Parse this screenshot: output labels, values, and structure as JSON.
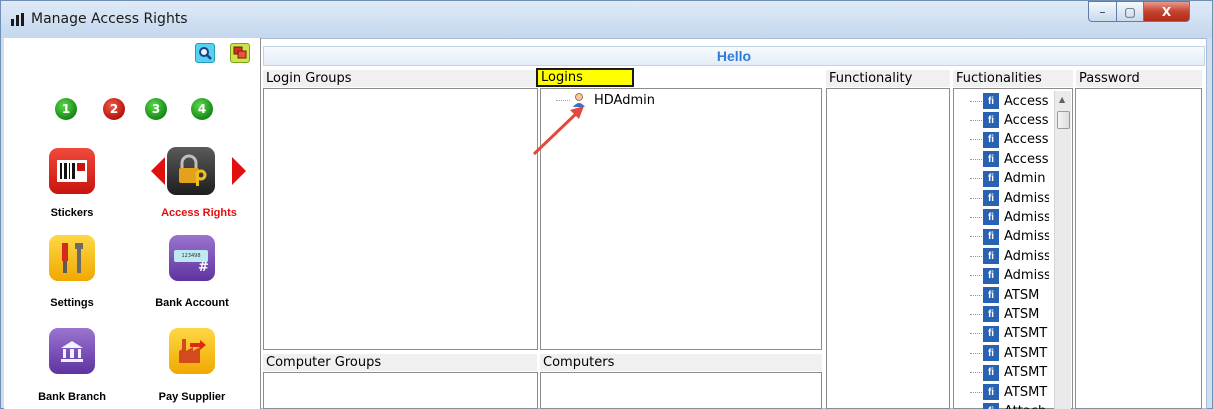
{
  "window": {
    "title": "Manage Access Rights",
    "controls": {
      "minimize": "–",
      "maximize": "▢",
      "close": "X"
    }
  },
  "toolbar": {
    "search_icon": "search-icon",
    "window_icon": "windows-icon"
  },
  "steps": [
    "1",
    "2",
    "3",
    "4"
  ],
  "tiles": [
    {
      "label": "Stickers",
      "icon": "barcode-icon"
    },
    {
      "label": "Access Rights",
      "icon": "padlock-key-icon"
    },
    {
      "label": "Settings",
      "icon": "tools-icon"
    },
    {
      "label": "Bank Account",
      "icon": "bank-account-icon",
      "icon_text": "123498",
      "icon_hash": "#"
    },
    {
      "label": "Bank Branch",
      "icon": "bank-building-icon"
    },
    {
      "label": "Pay Supplier",
      "icon": "factory-icon"
    }
  ],
  "main": {
    "hello": "Hello",
    "headers": {
      "login_groups": "Login Groups",
      "logins": "Logins",
      "functionality": "Functionality",
      "fuctionalities": "Fuctionalities",
      "password": "Password",
      "computer_groups": "Computer Groups",
      "computers": "Computers"
    },
    "logins": [
      {
        "name": "HDAdmin"
      }
    ],
    "functionalities": [
      "Access",
      "Access",
      "Access",
      "Access",
      "Admin",
      "Admiss",
      "Admiss",
      "Admiss",
      "Admiss",
      "Admiss",
      "ATSM",
      "ATSM",
      "ATSMT",
      "ATSMT",
      "ATSMT",
      "ATSMT",
      "Attach"
    ],
    "fi_badge": "fi"
  },
  "colors": {
    "accent": "#2e7cd9",
    "active_label": "#e20f0f",
    "highlight": "#ffff00"
  }
}
